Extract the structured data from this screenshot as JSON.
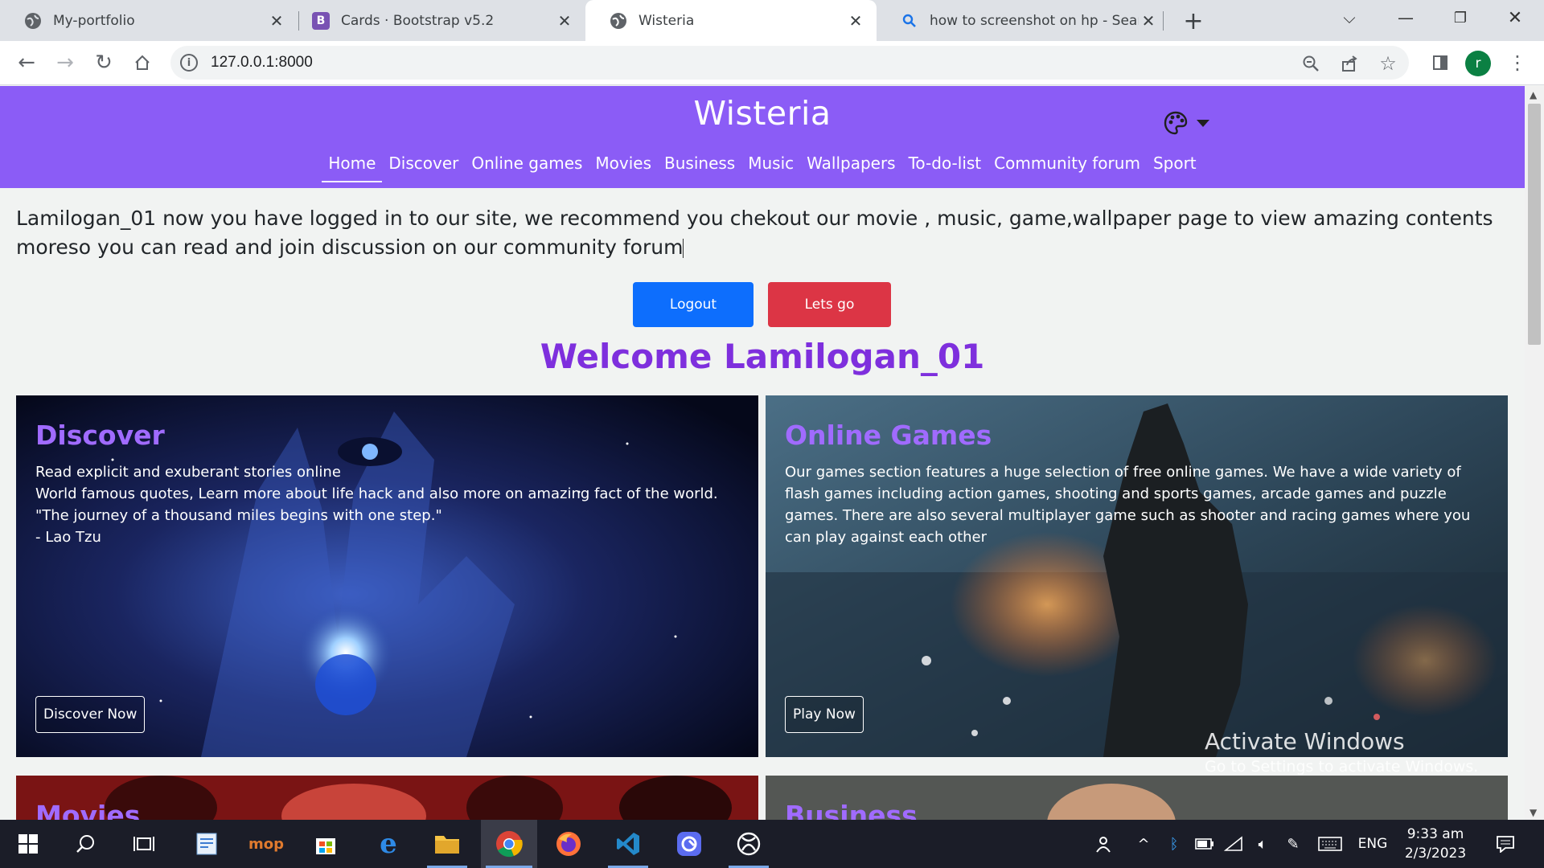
{
  "browser": {
    "tabs": [
      {
        "title": "My-portfolio",
        "icon": "globe-icon"
      },
      {
        "title": "Cards · Bootstrap v5.2",
        "icon": "bootstrap-icon"
      },
      {
        "title": "Wisteria",
        "icon": "globe-icon"
      },
      {
        "title": "how to screenshot on hp - Search",
        "icon": "search-icon"
      }
    ],
    "url": "127.0.0.1:8000",
    "profile_initial": "r",
    "favicon_letter": "B"
  },
  "site": {
    "brand": "Wisteria",
    "nav": [
      "Home",
      "Discover",
      "Online games",
      "Movies",
      "Business",
      "Music",
      "Wallpapers",
      "To-do-list",
      "Community forum",
      "Sport"
    ],
    "intro": "Lamilogan_01 now you have logged in to our site, we recommend you chekout our movie , music, game,wallpaper page to view amazing contents moreso you can read and join discussion on our community forum",
    "logout_label": "Logout",
    "go_label": "Lets go",
    "welcome": "Welcome Lamilogan_01",
    "cards": {
      "discover": {
        "title": "Discover",
        "lines": [
          "Read explicit and exuberant stories online",
          "World famous quotes, Learn more about life hack and also more on amazing fact of the world.",
          "\"The journey of a thousand miles begins with one step.\"",
          "- Lao Tzu"
        ],
        "button": "Discover Now"
      },
      "games": {
        "title": "Online Games",
        "text": "Our games section features a huge selection of free online games. We have a wide variety of flash games including action games, shooting and sports games, arcade games and puzzle games. There are also several multiplayer game such as shooter and racing games where you can play against each other",
        "button": "Play Now"
      },
      "movies": {
        "title": "Movies"
      },
      "business": {
        "title": "Business"
      }
    }
  },
  "watermark": {
    "line1": "Activate Windows",
    "line2": "Go to Settings to activate Windows."
  },
  "taskbar": {
    "language": "ENG",
    "time": "9:33 am",
    "date": "2/3/2023"
  },
  "colors": {
    "header": "#8b5cf6",
    "welcome": "#7e2fdd",
    "logout": "#0d6efd",
    "go": "#dc3545"
  }
}
